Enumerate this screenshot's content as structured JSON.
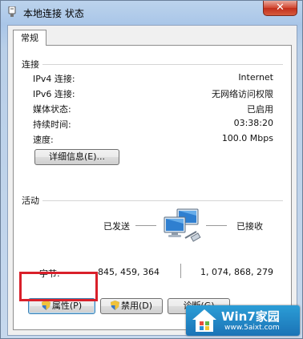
{
  "window": {
    "title": "本地连接 状态",
    "close_glyph": "✕"
  },
  "tabs": [
    {
      "label": "常规"
    }
  ],
  "connection": {
    "group_label": "连接",
    "rows": [
      {
        "label": "IPv4 连接:",
        "value": "Internet"
      },
      {
        "label": "IPv6 连接:",
        "value": "无网络访问权限"
      },
      {
        "label": "媒体状态:",
        "value": "已启用"
      },
      {
        "label": "持续时间:",
        "value": "03:38:20"
      },
      {
        "label": "速度:",
        "value": "100.0 Mbps"
      }
    ],
    "details_button": "详细信息(E)..."
  },
  "activity": {
    "group_label": "活动",
    "sent_label": "已发送",
    "received_label": "已接收",
    "bytes_label": "字节:",
    "sent_bytes": "845, 459, 364",
    "received_bytes": "1, 074, 868, 279",
    "icon": "network-computers-icon"
  },
  "buttons": {
    "properties": "属性(P)",
    "disable": "禁用(D)",
    "diagnose": "诊断(G)"
  },
  "watermark": {
    "brand": "Win7家园",
    "url": "www.5aixt.com"
  },
  "colors": {
    "highlight": "#d9202a",
    "title_gradient": "#a9c6e8"
  }
}
